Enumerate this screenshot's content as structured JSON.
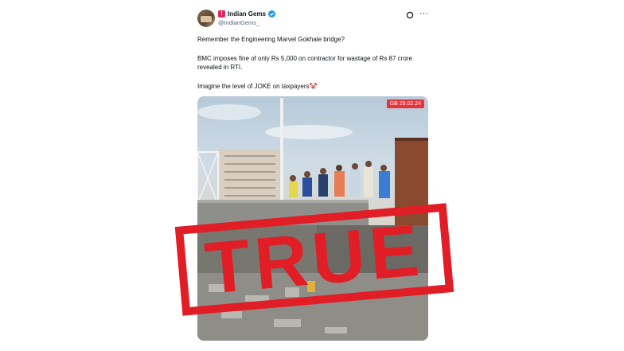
{
  "tweet": {
    "display_name": "Indian Gems",
    "handle": "@IndianGems_",
    "line1": "Remember the Engineering Marvel Gokhale bridge?",
    "line2": "BMC imposes fine of only Rs 5,000 on contractor for wastage of Rs 87 crore revealed in RTI.",
    "line3": "Imagine the level of JOKE on taxpayers",
    "emoji": "🤡",
    "verified_color": "#1d9bf0"
  },
  "media": {
    "date_badge": "GB 29.02.24"
  },
  "stamp": {
    "text": "TRUE",
    "color": "#e11d26"
  }
}
